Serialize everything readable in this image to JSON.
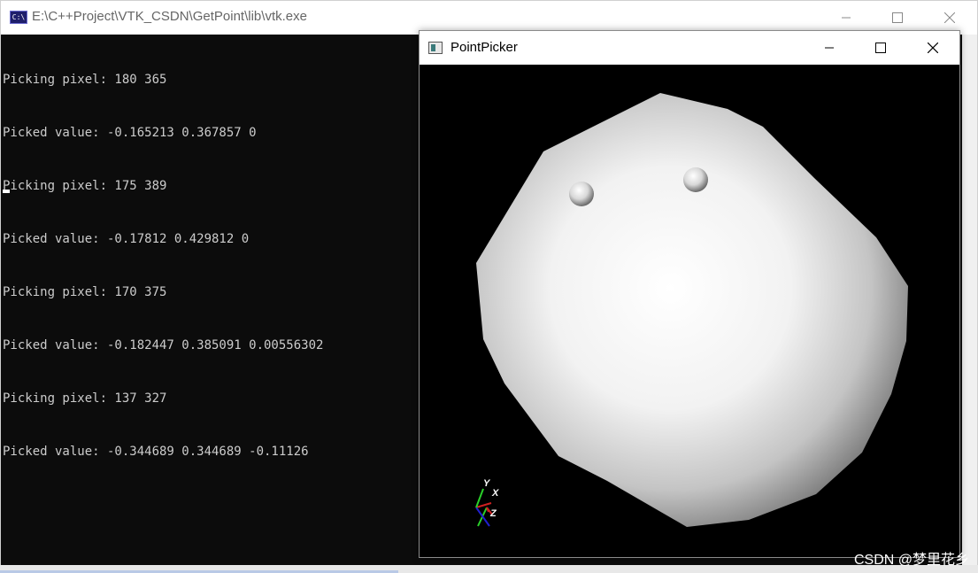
{
  "console_window": {
    "title": "E:\\C++Project\\VTK_CSDN\\GetPoint\\lib\\vtk.exe",
    "icon": "console-app-icon",
    "icon_text": "C:\\",
    "lines": [
      "Picking pixel: 180 365",
      "Picked value: -0.165213 0.367857 0",
      "Picking pixel: 175 389",
      "Picked value: -0.17812 0.429812 0",
      "Picking pixel: 170 375",
      "Picked value: -0.182447 0.385091 0.00556302",
      "Picking pixel: 137 327",
      "Picked value: -0.344689 0.344689 -0.11126"
    ],
    "text_color": "#cccccc",
    "background": "#0c0c0c"
  },
  "picker_window": {
    "title": "PointPicker",
    "icon": "vtk-window-icon",
    "background": "#000000",
    "axes": {
      "y_label": "Y",
      "x_label": "X",
      "z_label": "Z"
    }
  },
  "watermark": "CSDN @梦里花乡"
}
